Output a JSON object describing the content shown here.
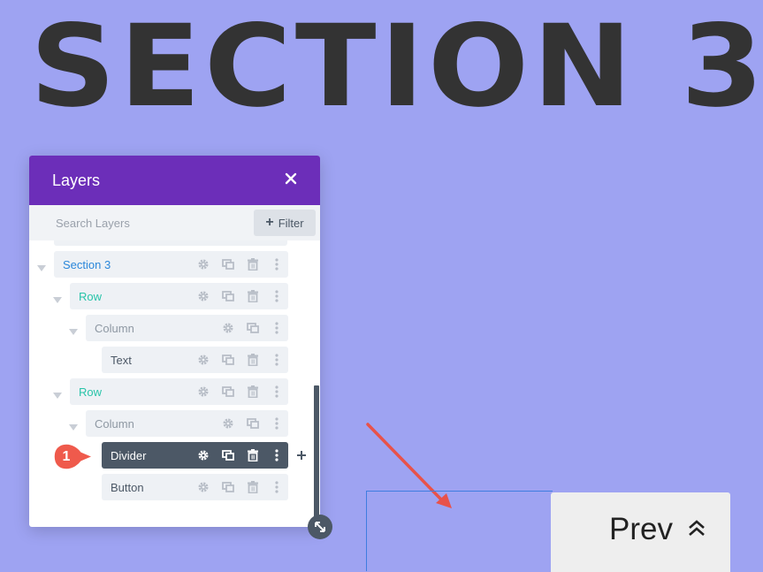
{
  "hero": {
    "title": "SECTION 3"
  },
  "layers_panel": {
    "title": "Layers",
    "search_placeholder": "Search Layers",
    "filter_label": "Filter",
    "items": [
      {
        "label": "Section 3",
        "type": "section",
        "color": "#2b87da"
      },
      {
        "label": "Row",
        "type": "row",
        "color": "#29c4a9"
      },
      {
        "label": "Column",
        "type": "column",
        "color": "#8e98a3"
      },
      {
        "label": "Text",
        "type": "module",
        "color": "#4c5866"
      },
      {
        "label": "Row",
        "type": "row",
        "color": "#29c4a9"
      },
      {
        "label": "Column",
        "type": "column",
        "color": "#8e98a3"
      },
      {
        "label": "Divider",
        "type": "module",
        "selected": true,
        "color": "#ffffff"
      },
      {
        "label": "Button",
        "type": "module",
        "color": "#4c5866"
      }
    ]
  },
  "callout": {
    "number": "1",
    "color": "#ef5a4c"
  },
  "page": {
    "prev_button_label": "Prev",
    "background": "#9ea3f2",
    "accent": "#6c2eb9"
  }
}
